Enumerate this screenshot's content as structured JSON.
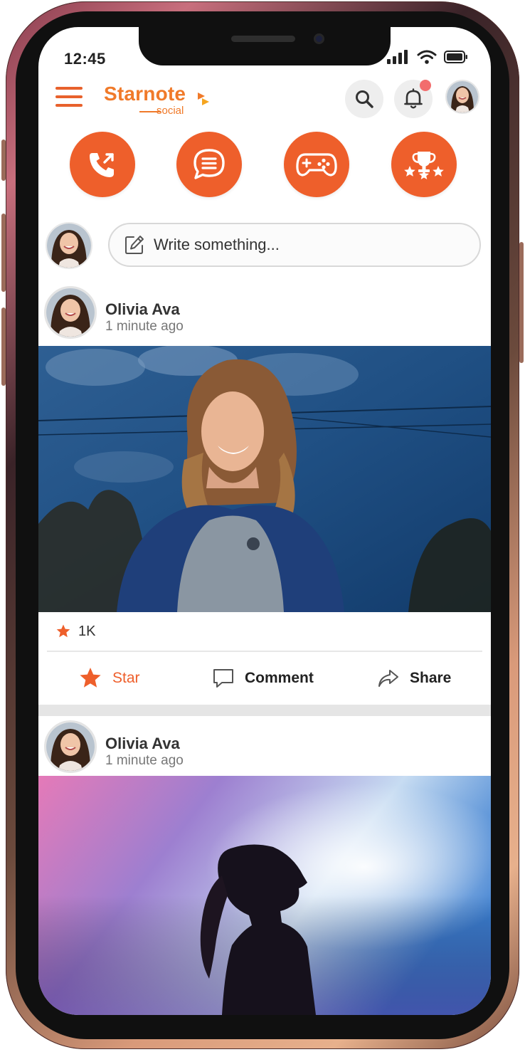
{
  "status_bar": {
    "time": "12:45"
  },
  "app": {
    "logo_name": "Starnote",
    "logo_sub": "social"
  },
  "header": {
    "icons": [
      "menu-icon",
      "search-icon",
      "bell-icon",
      "avatar"
    ]
  },
  "quick_actions": [
    {
      "name": "calls",
      "icon": "phone-call-icon"
    },
    {
      "name": "messages",
      "icon": "chat-bubble-icon"
    },
    {
      "name": "games",
      "icon": "gamepad-icon"
    },
    {
      "name": "achievements",
      "icon": "trophy-stars-icon"
    }
  ],
  "composer": {
    "placeholder": "Write something..."
  },
  "posts": [
    {
      "author": "Olivia Ava",
      "time": "1 minute ago",
      "stars": "1K",
      "actions": {
        "star": "Star",
        "comment": "Comment",
        "share": "Share"
      }
    },
    {
      "author": "Olivia Ava",
      "time": "1 minute ago"
    }
  ],
  "colors": {
    "accent": "#ee5f2b",
    "brand": "#f07a2a",
    "notification": "#f26d6d"
  }
}
